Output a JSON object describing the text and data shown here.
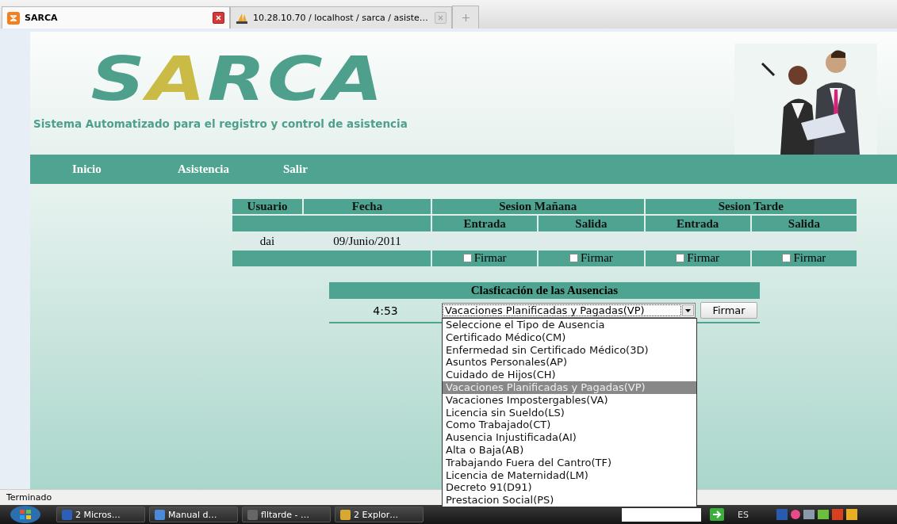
{
  "browser_tabs": [
    {
      "title": "SARCA",
      "selected": true
    },
    {
      "title": "10.28.10.70 / localhost / sarca / asiste…",
      "selected": false
    }
  ],
  "header": {
    "logo": [
      {
        "text": "S",
        "color": "#4ea08c"
      },
      {
        "text": "A",
        "color": "#c9bb45"
      },
      {
        "text": "RCA",
        "color": "#4ea08c"
      }
    ],
    "subtitle": "Sistema Automatizado para el registro y control de asistencia"
  },
  "nav": [
    "Inicio",
    "Asistencia",
    "Salir"
  ],
  "attendance": {
    "columns": [
      "Usuario",
      "Fecha"
    ],
    "sessions": [
      {
        "title": "Sesion Mañana",
        "subcolumns": [
          "Entrada",
          "Salida"
        ]
      },
      {
        "title": "Sesion Tarde",
        "subcolumns": [
          "Entrada",
          "Salida"
        ]
      }
    ],
    "row": {
      "user": "dai",
      "date": "09/Junio/2011"
    },
    "sign": [
      {
        "label": "Firmar",
        "checked": false
      },
      {
        "label": "Firmar",
        "checked": false
      },
      {
        "label": "Firmar",
        "checked": false
      },
      {
        "label": "Firmar",
        "checked": false
      }
    ]
  },
  "absence": {
    "title": "Clasficación de las Ausencias",
    "time": "4:53",
    "value": "Vacaciones Planificadas y Pagadas(VP)",
    "button": "Firmar",
    "expanded": true,
    "options": [
      {
        "label": "Seleccione el Tipo de Ausencia",
        "selected": false
      },
      {
        "label": "Certificado Médico(CM)",
        "selected": false
      },
      {
        "label": "Enfermedad sin Certificado Médico(3D)",
        "selected": false
      },
      {
        "label": "Asuntos Personales(AP)",
        "selected": false
      },
      {
        "label": "Cuidado de Hijos(CH)",
        "selected": false
      },
      {
        "label": "Vacaciones Planificadas y Pagadas(VP)",
        "selected": true
      },
      {
        "label": "Vacaciones Impostergables(VA)",
        "selected": false
      },
      {
        "label": "Licencia sin Sueldo(LS)",
        "selected": false
      },
      {
        "label": "Como Trabajado(CT)",
        "selected": false
      },
      {
        "label": "Ausencia Injustificada(AI)",
        "selected": false
      },
      {
        "label": "Alta o Baja(AB)",
        "selected": false
      },
      {
        "label": "Trabajando Fuera del Cantro(TF)",
        "selected": false
      },
      {
        "label": "Licencia de Maternidad(LM)",
        "selected": false
      },
      {
        "label": "Decreto 91(D91)",
        "selected": false
      },
      {
        "label": "Prestacion Social(PS)",
        "selected": false
      }
    ]
  },
  "status_bar": "Terminado",
  "taskbar": {
    "items": [
      "2 Micros…",
      "Manual d…",
      "flltarde - …",
      "2 Explor…"
    ],
    "language": "ES"
  }
}
